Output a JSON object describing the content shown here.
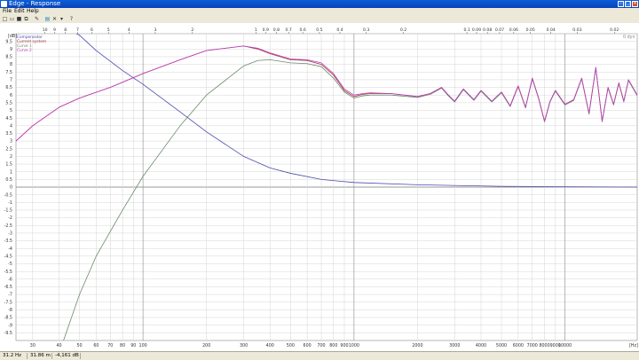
{
  "window": {
    "title": "Edge - Response"
  },
  "menu": [
    "File",
    "Edit",
    "Help"
  ],
  "toolbar": {
    "icons": [
      "new-icon",
      "open-icon",
      "save-icon",
      "copy-icon",
      "measure-icon",
      "window-icon",
      "close-icon",
      "dropdown-icon",
      "help-icon"
    ],
    "glyphs": [
      "□",
      "▭",
      "■",
      "⧉",
      "✎",
      "▤",
      "✕",
      "▾",
      "?"
    ]
  },
  "status": {
    "frequency": "31.2 Hz",
    "wavelength": "31.86 m",
    "level": "-4,161 dB"
  },
  "chart_data": {
    "type": "line",
    "xscale": "log",
    "xlim": [
      25,
      22000
    ],
    "ylim": [
      -10,
      10
    ],
    "yunit": "[dB]",
    "xunit": "[Hz]",
    "corner_label": "0 dyn",
    "yticks": [
      10,
      9.5,
      9,
      8.5,
      8,
      7.5,
      7,
      6.5,
      6,
      5.5,
      5,
      4.5,
      4,
      3.5,
      3,
      2.5,
      2,
      1.5,
      1,
      0.5,
      0,
      -0.5,
      -1,
      -1.5,
      -2,
      -2.5,
      -3,
      -3.5,
      -4,
      -4.5,
      -5,
      -5.5,
      -6,
      -6.5,
      -7,
      -7.5,
      -8,
      -8.5,
      -9,
      -9.5
    ],
    "ytick_labels": [
      "",
      "9.5",
      "9",
      "8.5",
      "8",
      "7.5",
      "7",
      "6.5",
      "6",
      "5.5",
      "5",
      "4.5",
      "4",
      "3.5",
      "3",
      "2.5",
      "2",
      "1.5",
      "1",
      "0.5",
      "0",
      "-0.5",
      "-1",
      "-1.5",
      "-2",
      "-2.5",
      "-3",
      "-3.5",
      "-4",
      "-4.5",
      "-5",
      "-5.5",
      "-6",
      "-6.5",
      "-7",
      "-7.5",
      "-8",
      "-8.5",
      "-9",
      "-9.5"
    ],
    "xticks": [
      {
        "f": 30,
        "label": "30"
      },
      {
        "f": 40,
        "label": "40"
      },
      {
        "f": 50,
        "label": "50"
      },
      {
        "f": 60,
        "label": "60"
      },
      {
        "f": 70,
        "label": "70"
      },
      {
        "f": 80,
        "label": "80"
      },
      {
        "f": 90,
        "label": "90"
      },
      {
        "f": 100,
        "label": "100"
      },
      {
        "f": 200,
        "label": "200"
      },
      {
        "f": 300,
        "label": "300"
      },
      {
        "f": 400,
        "label": "400"
      },
      {
        "f": 500,
        "label": "500"
      },
      {
        "f": 600,
        "label": "600"
      },
      {
        "f": 700,
        "label": "700"
      },
      {
        "f": 800,
        "label": "800"
      },
      {
        "f": 900,
        "label": "900"
      },
      {
        "f": 1000,
        "label": "1000"
      },
      {
        "f": 2000,
        "label": "2000"
      },
      {
        "f": 3000,
        "label": "3000"
      },
      {
        "f": 4000,
        "label": "4000"
      },
      {
        "f": 5000,
        "label": "5000"
      },
      {
        "f": 6000,
        "label": "6000"
      },
      {
        "f": 7000,
        "label": "7000"
      },
      {
        "f": 8000,
        "label": "8000"
      },
      {
        "f": 9000,
        "label": "9000"
      },
      {
        "f": 10000,
        "label": "10000"
      },
      {
        "f": 22000,
        "label": "[Hz]"
      }
    ],
    "top_axis_ticks": [
      {
        "f": 34.3,
        "label": "10"
      },
      {
        "f": 38.1,
        "label": "9"
      },
      {
        "f": 42.9,
        "label": "8"
      },
      {
        "f": 49.0,
        "label": "7"
      },
      {
        "f": 57.2,
        "label": "6"
      },
      {
        "f": 68.6,
        "label": "5"
      },
      {
        "f": 85.8,
        "label": "4"
      },
      {
        "f": 114.3,
        "label": "3"
      },
      {
        "f": 171.5,
        "label": "2"
      },
      {
        "f": 343,
        "label": "1"
      },
      {
        "f": 381,
        "label": "0.9"
      },
      {
        "f": 428.8,
        "label": "0.8"
      },
      {
        "f": 490,
        "label": "0.7"
      },
      {
        "f": 571.7,
        "label": "0.6"
      },
      {
        "f": 686,
        "label": "0.5"
      },
      {
        "f": 857.5,
        "label": "0.4"
      },
      {
        "f": 1143,
        "label": "0.3"
      },
      {
        "f": 1715,
        "label": "0.2"
      },
      {
        "f": 3430,
        "label": "0.1"
      },
      {
        "f": 3811,
        "label": "0.09"
      },
      {
        "f": 4288,
        "label": "0.08"
      },
      {
        "f": 4900,
        "label": "0.07"
      },
      {
        "f": 5717,
        "label": "0.06"
      },
      {
        "f": 6860,
        "label": "0.05"
      },
      {
        "f": 8575,
        "label": "0.04"
      },
      {
        "f": 11433,
        "label": "0.03"
      },
      {
        "f": 17150,
        "label": "0.02"
      }
    ],
    "legend_placement": "top-left",
    "series": [
      {
        "name": "Compensator",
        "color": "#4a4ab0",
        "x": [
          25,
          40,
          50,
          60,
          80,
          100,
          150,
          200,
          300,
          400,
          500,
          700,
          1000,
          2000,
          5000,
          10000,
          22000
        ],
        "y": [
          12,
          10.6,
          9.9,
          8.9,
          7.6,
          6.7,
          4.9,
          3.6,
          2.0,
          1.25,
          0.9,
          0.5,
          0.3,
          0.15,
          0.05,
          0.02,
          0.0
        ]
      },
      {
        "name": "Current system",
        "color": "#a0303a",
        "x": [
          25,
          30,
          40,
          50,
          70,
          100,
          150,
          200,
          300,
          350,
          400,
          500,
          600,
          700,
          800,
          900,
          1000,
          1100,
          1200,
          1500,
          2000,
          2300,
          2600,
          2800,
          3000,
          3300,
          3700,
          4000,
          4500,
          5000,
          5500,
          6000,
          6500,
          7000,
          7500,
          8000,
          8500,
          9000,
          10000,
          11000,
          12000,
          13000,
          14000,
          15000,
          16000,
          17000,
          18000,
          19000,
          20000,
          22000
        ],
        "y": [
          3.0,
          4.0,
          5.2,
          5.8,
          6.5,
          7.4,
          8.3,
          8.9,
          9.2,
          9.0,
          8.7,
          8.3,
          8.25,
          8.0,
          7.3,
          6.3,
          5.9,
          6.05,
          6.1,
          6.1,
          5.9,
          6.1,
          6.5,
          6.0,
          5.6,
          6.4,
          5.7,
          6.3,
          5.6,
          6.2,
          5.3,
          6.6,
          5.2,
          7.1,
          5.8,
          4.3,
          5.6,
          6.3,
          5.4,
          5.7,
          7.1,
          4.8,
          7.8,
          4.3,
          6.5,
          5.4,
          6.8,
          5.6,
          7.0,
          6.0
        ]
      },
      {
        "name": "Curve 1",
        "color": "#6a8a6a",
        "x": [
          42,
          50,
          60,
          80,
          100,
          150,
          200,
          300,
          350,
          400,
          500,
          600,
          700,
          800,
          900,
          1000,
          1100,
          1200,
          1500,
          2000,
          2300,
          2600,
          2800,
          3000,
          3300,
          3700,
          4000,
          4500,
          5000,
          5500,
          6000,
          6500,
          7000,
          7500,
          8000,
          8500,
          9000,
          10000,
          11000,
          12000,
          13000,
          14000,
          15000,
          16000,
          17000,
          18000,
          19000,
          20000,
          22000
        ],
        "y": [
          -10.0,
          -7.0,
          -4.5,
          -1.5,
          0.7,
          4.0,
          6.0,
          7.9,
          8.25,
          8.3,
          8.1,
          8.05,
          7.85,
          7.1,
          6.2,
          5.8,
          5.95,
          6.0,
          6.0,
          5.85,
          6.05,
          6.45,
          5.95,
          5.55,
          6.35,
          5.65,
          6.25,
          5.55,
          6.15,
          5.25,
          6.55,
          5.15,
          7.05,
          5.75,
          4.25,
          5.55,
          6.25,
          5.35,
          5.65,
          7.05,
          4.75,
          7.75,
          4.25,
          6.45,
          5.35,
          6.75,
          5.55,
          6.95,
          5.95
        ]
      },
      {
        "name": "Curve 2",
        "color": "#c040c0",
        "x": [
          25,
          30,
          40,
          50,
          70,
          100,
          150,
          200,
          300,
          350,
          400,
          500,
          600,
          700,
          800,
          900,
          1000,
          1100,
          1200,
          1500,
          2000,
          2300,
          2600,
          2800,
          3000,
          3300,
          3700,
          4000,
          4500,
          5000,
          5500,
          6000,
          6500,
          7000,
          7500,
          8000,
          8500,
          9000,
          10000,
          11000,
          12000,
          13000,
          14000,
          15000,
          16000,
          17000,
          18000,
          19000,
          20000,
          22000
        ],
        "y": [
          3.0,
          4.0,
          5.2,
          5.8,
          6.5,
          7.4,
          8.3,
          8.9,
          9.2,
          9.05,
          8.75,
          8.35,
          8.3,
          8.1,
          7.4,
          6.4,
          6.0,
          6.1,
          6.15,
          6.1,
          5.9,
          6.1,
          6.5,
          6.0,
          5.6,
          6.4,
          5.7,
          6.3,
          5.6,
          6.2,
          5.3,
          6.6,
          5.2,
          7.1,
          5.8,
          4.3,
          5.6,
          6.3,
          5.4,
          5.7,
          7.1,
          4.8,
          7.8,
          4.3,
          6.5,
          5.4,
          6.8,
          5.6,
          7.0,
          6.0
        ]
      }
    ]
  }
}
